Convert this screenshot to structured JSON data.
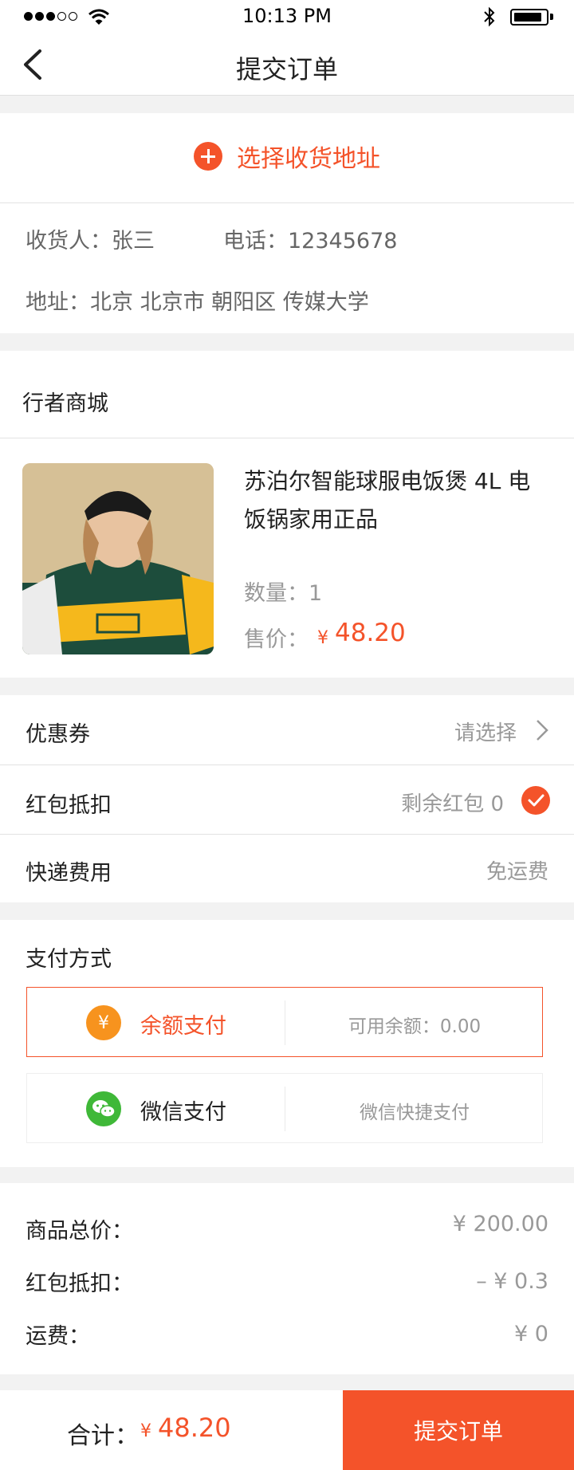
{
  "status_bar": {
    "time": "10:13 PM"
  },
  "nav": {
    "title": "提交订单"
  },
  "address": {
    "select_label": "选择收货地址",
    "recipient_label": "收货人：张三",
    "phone_label": "电话：12345678",
    "address_line": "地址：北京 北京市 朝阳区 传媒大学"
  },
  "store": {
    "name": "行者商城",
    "product": {
      "title": "苏泊尔智能球服电饭煲 4L 电饭锅家用正品",
      "quantity_label": "数量：1",
      "price_label": "售价：",
      "price_currency": "¥",
      "price_value": "48.20"
    }
  },
  "options": {
    "coupon_label": "优惠券",
    "coupon_value": "请选择",
    "redpacket_label": "红包抵扣",
    "redpacket_value": "剩余红包 0",
    "shipping_label": "快递费用",
    "shipping_value": "免运费"
  },
  "payment": {
    "title": "支付方式",
    "methods": [
      {
        "name": "余额支付",
        "desc": "可用余额：0.00",
        "icon": "yuan-icon",
        "color": "#f7931e",
        "selected": true
      },
      {
        "name": "微信支付",
        "desc": "微信快捷支付",
        "icon": "wechat-icon",
        "color": "#3fb838",
        "selected": false
      }
    ]
  },
  "summary": {
    "goods_total_label": "商品总价：",
    "goods_total_value": "¥ 200.00",
    "redpacket_label": "红包抵扣：",
    "redpacket_value": "– ¥ 0.3",
    "shipping_label": "运费：",
    "shipping_value": "¥ 0"
  },
  "footer": {
    "total_label": "合计：",
    "total_currency": "¥",
    "total_value": "48.20",
    "submit_label": "提交订单"
  },
  "colors": {
    "accent": "#f4532a",
    "background": "#f2f2f2"
  }
}
